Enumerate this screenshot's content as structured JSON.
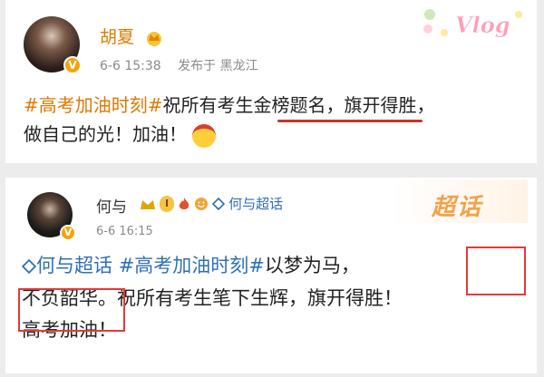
{
  "post1": {
    "username": "胡夏",
    "time": "6-6 15:38",
    "location": "发布于 黑龙江",
    "verified_glyph": "V",
    "hashtag": "#高考加油时刻#",
    "text_line1": "祝所有考生金榜题名，旗开得胜，",
    "text_line2": "做自己的光！加油！",
    "deco_text": "Vlog",
    "icons": [
      "crown-badge-icon",
      "cheering-face-emoji-icon",
      "vlog-sticker-icon"
    ]
  },
  "post2": {
    "username": "何与",
    "pill": "I",
    "supertopic_link": "何与超话",
    "time": "6-6 16:15",
    "verified_glyph": "V",
    "supertopic_tag": "何与超话",
    "hashtag": "#高考加油时刻#",
    "text_a": "以梦为马，",
    "text_b": "不负韶华。",
    "text_c": "祝所有考生笔下生辉，旗开得胜！",
    "text_line3": "高考加油！",
    "deco_text": "超话",
    "icons": [
      "crown-badge-icon",
      "flame-icon",
      "smile-icon",
      "supertopic-diamond-icon"
    ]
  },
  "colors": {
    "orange": "#e07800",
    "link_blue": "#2f6fb7",
    "highlight_red": "#e53935"
  }
}
